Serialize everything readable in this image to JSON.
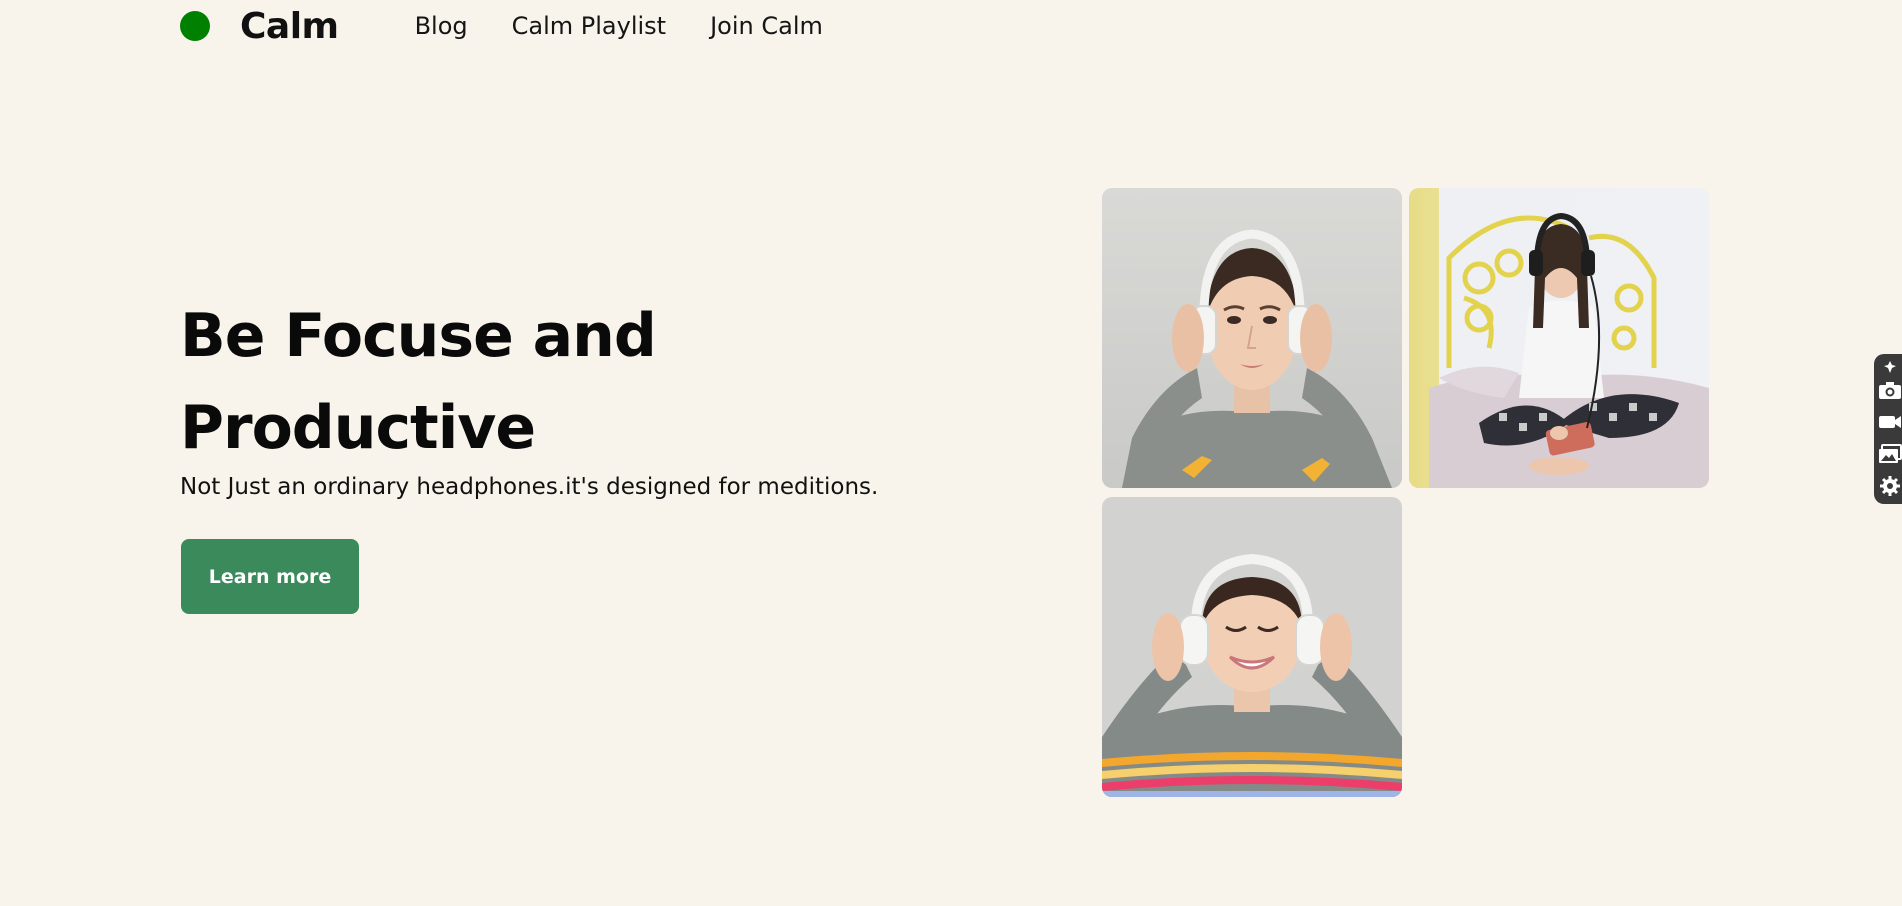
{
  "header": {
    "brand": "Calm",
    "nav": [
      {
        "label": "Blog"
      },
      {
        "label": "Calm Playlist"
      },
      {
        "label": "Join Calm"
      }
    ]
  },
  "hero": {
    "title_line1": "Be Focuse and",
    "title_line2": "Productive",
    "subtitle": "Not Just an ordinary headphones.it's designed for meditions.",
    "cta_label": "Learn more"
  },
  "gallery": {
    "images": [
      {
        "icon": "woman-headphones-photo"
      },
      {
        "icon": "girl-bed-headphones-photo"
      },
      {
        "icon": "woman-smiling-headphones-photo"
      }
    ]
  },
  "side_toolbar": {
    "icons": [
      "pin-icon",
      "camera-icon",
      "video-icon",
      "gallery-icon",
      "gear-icon"
    ]
  },
  "colors": {
    "background": "#f8f4ec",
    "logo_dot": "#008000",
    "cta": "#3b8a5c"
  }
}
